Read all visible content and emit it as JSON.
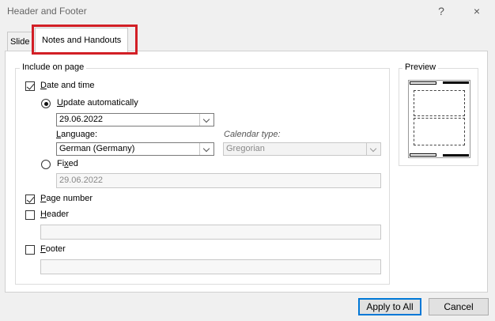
{
  "window": {
    "title": "Header and Footer",
    "help": "?",
    "close": "×"
  },
  "tabs": [
    {
      "label": "Slide"
    },
    {
      "label": "Notes and Handouts"
    }
  ],
  "include": {
    "group_label": "Include on page",
    "date_time": {
      "label": "Date and time",
      "checked": true,
      "update_auto": {
        "label": "Update automatically",
        "selected": true,
        "value": "29.06.2022"
      },
      "language": {
        "label": "Language:",
        "value": "German (Germany)"
      },
      "calendar": {
        "label": "Calendar type:",
        "value": "Gregorian"
      },
      "fixed": {
        "label": "Fixed",
        "selected": false,
        "value": "29.06.2022"
      }
    },
    "page_number": {
      "label": "Page number",
      "checked": true
    },
    "header": {
      "label": "Header",
      "checked": false,
      "value": ""
    },
    "footer": {
      "label": "Footer",
      "checked": false,
      "value": ""
    }
  },
  "preview": {
    "label": "Preview"
  },
  "buttons": {
    "apply_all": "Apply to All",
    "cancel": "Cancel"
  }
}
